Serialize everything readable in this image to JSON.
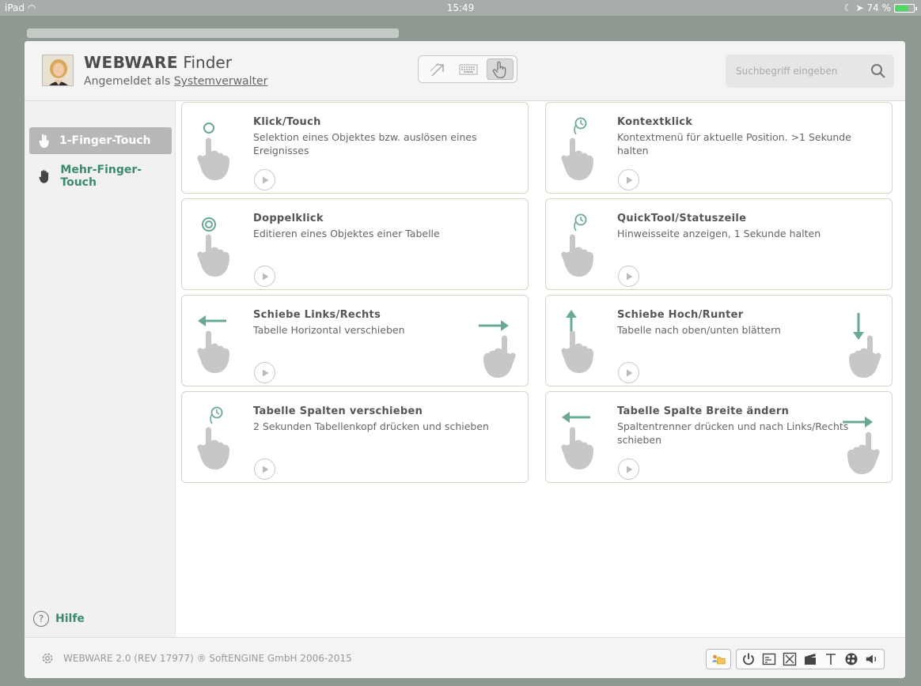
{
  "statusbar": {
    "device": "iPad",
    "time": "15:49",
    "battery": "74 %",
    "battery_level": 0.74
  },
  "header": {
    "title_bold": "WEBWARE",
    "title_rest": " Finder",
    "logged_in_prefix": "Angemeldet als ",
    "user": "Systemverwalter",
    "modes": [
      "pointer-mode",
      "keyboard-mode",
      "touch-mode"
    ],
    "active_mode": "touch-mode"
  },
  "search": {
    "placeholder": "Suchbegriff eingeben"
  },
  "sidebar": {
    "items": [
      {
        "label": "1-Finger-Touch",
        "active": true
      },
      {
        "label": "Mehr-Finger-Touch",
        "active": false
      }
    ],
    "help_label": "Hilfe"
  },
  "cards": [
    {
      "title": "Klick/Touch",
      "desc": "Selektion eines Objektes bzw. auslösen eines Ereignisses",
      "icon": "tap-icon"
    },
    {
      "title": "Kontextklick",
      "desc": "Kontextmenü für aktuelle Position. >1 Sekunde halten",
      "icon": "long-press-icon"
    },
    {
      "title": "Doppelklick",
      "desc": "Editieren eines Objektes einer Tabelle",
      "icon": "double-tap-icon"
    },
    {
      "title": "QuickTool/Statuszeile",
      "desc": "Hinweisseite anzeigen, 1 Sekunde halten",
      "icon": "long-press-icon"
    },
    {
      "title": "Schiebe Links/Rechts",
      "desc": "Tabelle Horizontal verschieben",
      "icon": "swipe-horizontal-icon"
    },
    {
      "title": "Schiebe Hoch/Runter",
      "desc": "Tabelle nach oben/unten blättern",
      "icon": "swipe-vertical-icon"
    },
    {
      "title": "Tabelle Spalten verschieben",
      "desc": "2 Sekunden Tabellenkopf drücken und schieben",
      "icon": "long-press-icon"
    },
    {
      "title": "Tabelle Spalte Breite ändern",
      "desc": "Spaltentrenner drücken und nach Links/Rechts schieben",
      "icon": "swipe-horizontal-icon"
    }
  ],
  "footer": {
    "copyright": "WEBWARE 2.0 (REV 17977) ® SoftENGINE GmbH 2006-2015",
    "tools": [
      "user-folder-icon",
      "power-icon",
      "terminal-icon",
      "close-window-icon",
      "clapperboard-icon",
      "text-icon",
      "palette-icon",
      "volume-icon"
    ]
  },
  "colors": {
    "accent_green": "#3a8b6b",
    "gesture_arrow": "#6aa896",
    "card_border": "#cfd8c0"
  }
}
